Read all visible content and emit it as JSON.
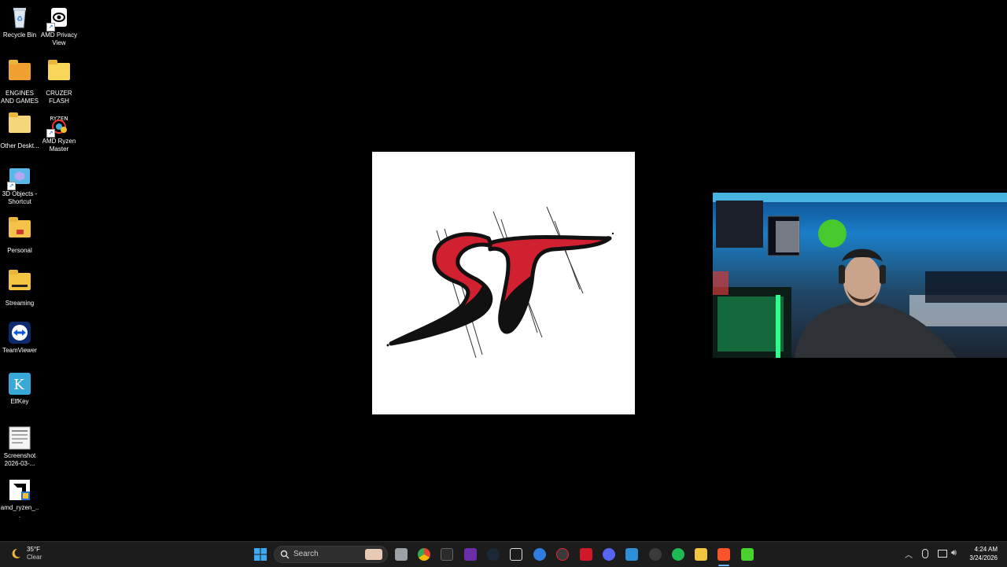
{
  "desktop": {
    "icons": [
      {
        "label": "Recycle Bin"
      },
      {
        "label": "AMD Privacy View"
      },
      {
        "label": "ENGINES AND GAMES"
      },
      {
        "label": "CRUZER FLASH"
      },
      {
        "label": "Other Deskt..."
      },
      {
        "label": "AMD Ryzen Master"
      },
      {
        "label": "3D Objects - Shortcut"
      },
      {
        "label": "Personal"
      },
      {
        "label": "Streaming"
      },
      {
        "label": "TeamViewer"
      },
      {
        "label": "ElfKey"
      },
      {
        "label": "Screenshot 2026-03-..."
      },
      {
        "label": "amd_ryzen_..."
      }
    ]
  },
  "taskbar": {
    "weather": {
      "temp": "35°F",
      "condition": "Clear"
    },
    "search_placeholder": "Search",
    "clock": {
      "time": "4:24 AM",
      "date": "3/24/2026"
    },
    "apps": [
      "start-icon",
      "file-tool-icon",
      "chrome-icon",
      "terminal-icon",
      "nzxt-icon",
      "steam-icon",
      "rl-icon",
      "edge-icon",
      "clock-icon",
      "red-app-icon",
      "discord-icon",
      "photos-icon",
      "settings-app-icon",
      "spotify-icon",
      "files-icon",
      "brave-icon",
      "bf-icon"
    ],
    "tray": [
      "chevron-up-icon",
      "mic-icon",
      "display-icon",
      "speaker-icon"
    ]
  },
  "colors": {
    "taskbar_bg": "#1c1c1c",
    "desktop_bg": "#000000",
    "logo_red": "#d12030"
  }
}
